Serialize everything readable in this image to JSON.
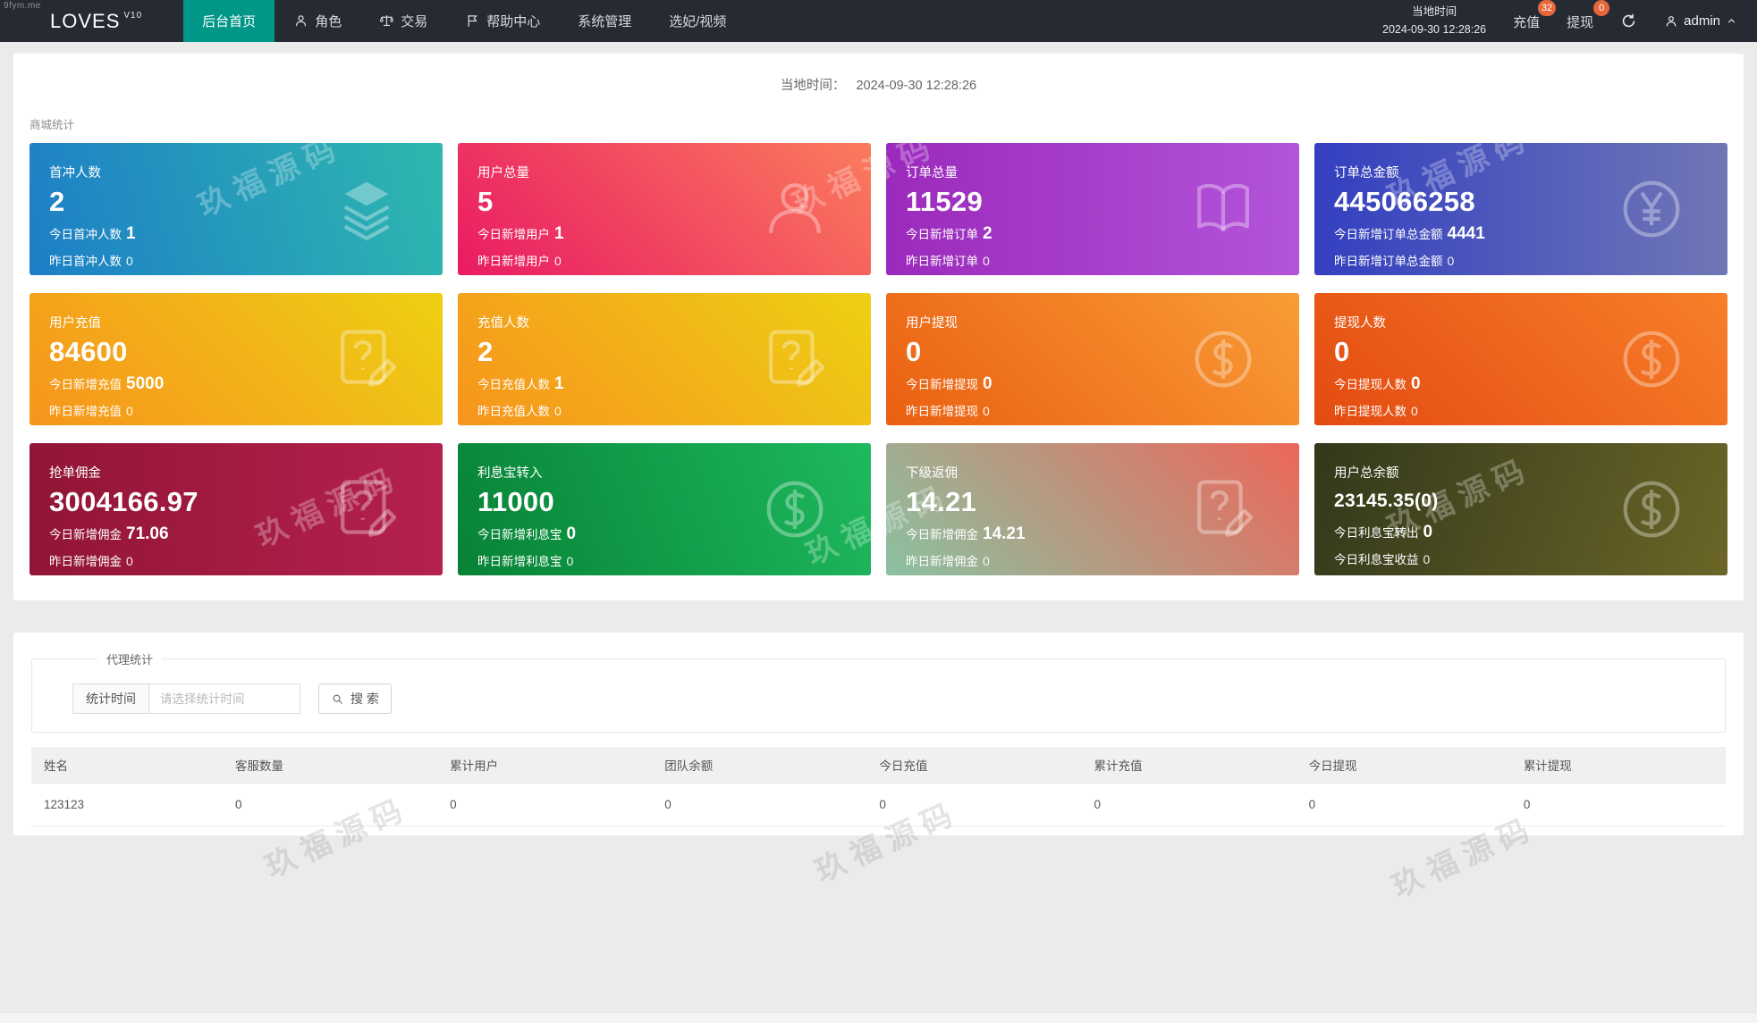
{
  "watermark": {
    "site": "9fym.me",
    "text": "玖福源码"
  },
  "navbar": {
    "logo": "LOVES",
    "logo_version": "V10",
    "items": [
      {
        "label": "后台首页",
        "icon": null,
        "active": true
      },
      {
        "label": "角色",
        "icon": "person-icon",
        "active": false
      },
      {
        "label": "交易",
        "icon": "scales-icon",
        "active": false
      },
      {
        "label": "帮助中心",
        "icon": "flag-icon",
        "active": false
      },
      {
        "label": "系统管理",
        "icon": null,
        "active": false
      },
      {
        "label": "选妃/视频",
        "icon": null,
        "active": false
      }
    ],
    "local_time_label": "当地时间",
    "local_time_value": "2024-09-30 12:28:26",
    "recharge": {
      "label": "充值",
      "badge": "32"
    },
    "withdraw": {
      "label": "提现",
      "badge": "0"
    },
    "user": "admin"
  },
  "main": {
    "time_label": "当地时间：",
    "time_value": "2024-09-30 12:28:26",
    "section_title": "商城统计",
    "cards": [
      {
        "title": "首冲人数",
        "value": "2",
        "sub1_label": "今日首冲人数",
        "sub1_value": "1",
        "sub2_label": "昨日首冲人数",
        "sub2_value": "0",
        "icon": "layers-icon",
        "gradient": {
          "angle": "75deg",
          "from": "#1d7ec7",
          "to": "#2eb8ae"
        }
      },
      {
        "title": "用户总量",
        "value": "5",
        "sub1_label": "今日新增用户",
        "sub1_value": "1",
        "sub2_label": "昨日新增用户",
        "sub2_value": "0",
        "icon": "user-icon",
        "gradient": {
          "angle": "45deg",
          "from": "#e91a63",
          "to": "#fb7c5d"
        }
      },
      {
        "title": "订单总量",
        "value": "11529",
        "sub1_label": "今日新增订单",
        "sub1_value": "2",
        "sub2_label": "昨日新增订单",
        "sub2_value": "0",
        "icon": "book-icon",
        "gradient": {
          "angle": "90deg",
          "from": "#9b2abc",
          "to": "#b354da"
        }
      },
      {
        "title": "订单总金额",
        "value": "445066258",
        "sub1_label": "今日新增订单总金额",
        "sub1_value": "4441",
        "sub2_label": "昨日新增订单总金额",
        "sub2_value": "0",
        "icon": "yen-icon",
        "gradient": {
          "angle": "90deg",
          "from": "#333fc0",
          "to": "#7077b6"
        }
      },
      {
        "title": "用户充值",
        "value": "84600",
        "sub1_label": "今日新增充值",
        "sub1_value": "5000",
        "sub2_label": "昨日新增充值",
        "sub2_value": "0",
        "icon": "edit-doc-icon",
        "gradient": {
          "angle": "45deg",
          "from": "#f7941d",
          "to": "#edd013"
        }
      },
      {
        "title": "充值人数",
        "value": "2",
        "sub1_label": "今日充值人数",
        "sub1_value": "1",
        "sub2_label": "昨日充值人数",
        "sub2_value": "0",
        "icon": "edit-doc-icon",
        "gradient": {
          "angle": "45deg",
          "from": "#f7941d",
          "to": "#edd013"
        }
      },
      {
        "title": "用户提现",
        "value": "0",
        "sub1_label": "今日新增提现",
        "sub1_value": "0",
        "sub2_label": "昨日新增提现",
        "sub2_value": "0",
        "icon": "dollar-icon",
        "gradient": {
          "angle": "45deg",
          "from": "#ea5f12",
          "to": "#f99d36"
        }
      },
      {
        "title": "提现人数",
        "value": "0",
        "sub1_label": "今日提现人数",
        "sub1_value": "0",
        "sub2_label": "昨日提现人数",
        "sub2_value": "0",
        "icon": "dollar-icon",
        "gradient": {
          "angle": "45deg",
          "from": "#e34b10",
          "to": "#f87f2a"
        }
      },
      {
        "title": "抢单佣金",
        "value": "3004166.97",
        "sub1_label": "今日新增佣金",
        "sub1_value": "71.06",
        "sub2_label": "昨日新增佣金",
        "sub2_value": "0",
        "icon": "edit-doc-icon",
        "gradient": {
          "angle": "90deg",
          "from": "#911535",
          "to": "#b5214e"
        }
      },
      {
        "title": "利息宝转入",
        "value": "11000",
        "sub1_label": "今日新增利息宝",
        "sub1_value": "0",
        "sub2_label": "昨日新增利息宝",
        "sub2_value": "0",
        "icon": "dollar-icon",
        "gradient": {
          "angle": "70deg",
          "from": "#078236",
          "to": "#1eb95e"
        }
      },
      {
        "title": "下级返佣",
        "value": "14.21",
        "sub1_label": "今日新增佣金",
        "sub1_value": "14.21",
        "sub2_label": "昨日新增佣金",
        "sub2_value": "0",
        "icon": "edit-doc-icon",
        "gradient": {
          "angle": "45deg",
          "from": "#8ac2a1",
          "to": "#ec675a"
        }
      },
      {
        "title": "用户总余额",
        "value": "23145.35(0)",
        "small_value": true,
        "sub1_label": "今日利息宝转出",
        "sub1_value": "0",
        "sub2_label": "今日利息宝收益",
        "sub2_value": "0",
        "icon": "dollar-icon",
        "gradient": {
          "angle": "110deg",
          "from": "#32381b",
          "to": "#6b6527"
        }
      }
    ]
  },
  "agent": {
    "legend": "代理统计",
    "filter_label": "统计时间",
    "filter_placeholder": "请选择统计时间",
    "search_label": "搜 索",
    "table": {
      "headers": [
        "姓名",
        "客服数量",
        "累计用户",
        "团队余额",
        "今日充值",
        "累计充值",
        "今日提现",
        "累计提现"
      ],
      "rows": [
        [
          "123123",
          "0",
          "0",
          "0",
          "0",
          "0",
          "0",
          "0"
        ]
      ]
    }
  }
}
